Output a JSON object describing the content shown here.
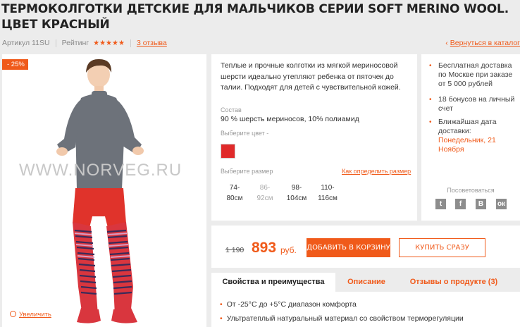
{
  "title": "ТЕРМОКОЛГОТКИ ДЕТСКИЕ ДЛЯ МАЛЬЧИКОВ СЕРИИ SOFT MERINO WOOL. ЦВЕТ КРАСНЫЙ",
  "meta": {
    "article": "Артикул 11SU",
    "rating_label": "Рейтинг",
    "stars": "★★★★★",
    "reviews": "3 отзыва",
    "back": "Вернуться в каталог"
  },
  "image": {
    "discount": "- 25%",
    "watermark": "WWW.NORVEG.RU",
    "zoom": "Увеличить"
  },
  "description": {
    "text": "Теплые и прочные колготки из мягкой мериносовой шерсти идеально утепляют ребенка от пяточек до талии. Подходят для детей с чувствительной кожей.",
    "composition_label": "Состав",
    "composition": "90 % шерсть мериносов, 10% полиамид",
    "color_label": "Выберите цвет -",
    "color_value": "#e02a2a",
    "size_label": "Выберите размер",
    "size_help": "Как определить размер",
    "sizes": [
      {
        "top": "74-",
        "bottom": "80см"
      },
      {
        "top": "86-",
        "bottom": "92см"
      },
      {
        "top": "98-",
        "bottom": "104см"
      },
      {
        "top": "110-",
        "bottom": "116см"
      }
    ]
  },
  "side": {
    "delivery": "Бесплатная доставка по Москве при заказе от 5 000 рублей",
    "bonus": "18 бонусов на личный счет",
    "date_label": "Ближайшая дата доставки:",
    "date_value": "Понедельник, 21 Ноября",
    "share": "Посоветоваться",
    "socials": [
      "twitter-icon",
      "facebook-icon",
      "vk-icon",
      "odnoklassniki-icon"
    ]
  },
  "buy": {
    "old_price": "1 190",
    "price": "893",
    "currency": "руб.",
    "add_to_cart": "ДОБАВИТЬ В КОРЗИНУ",
    "buy_now": "КУПИТЬ СРАЗУ"
  },
  "tabs": [
    "Свойства и преимущества",
    "Описание",
    "Отзывы о продукте (3)"
  ],
  "properties": [
    "От -25°С до +5°С диапазон комфорта",
    "Ультратеплый натуральный материал со свойством терморегуляции"
  ],
  "colors": {
    "accent": "#f05a1a",
    "sweater": "#6d727a",
    "tights": "#e0332b"
  }
}
